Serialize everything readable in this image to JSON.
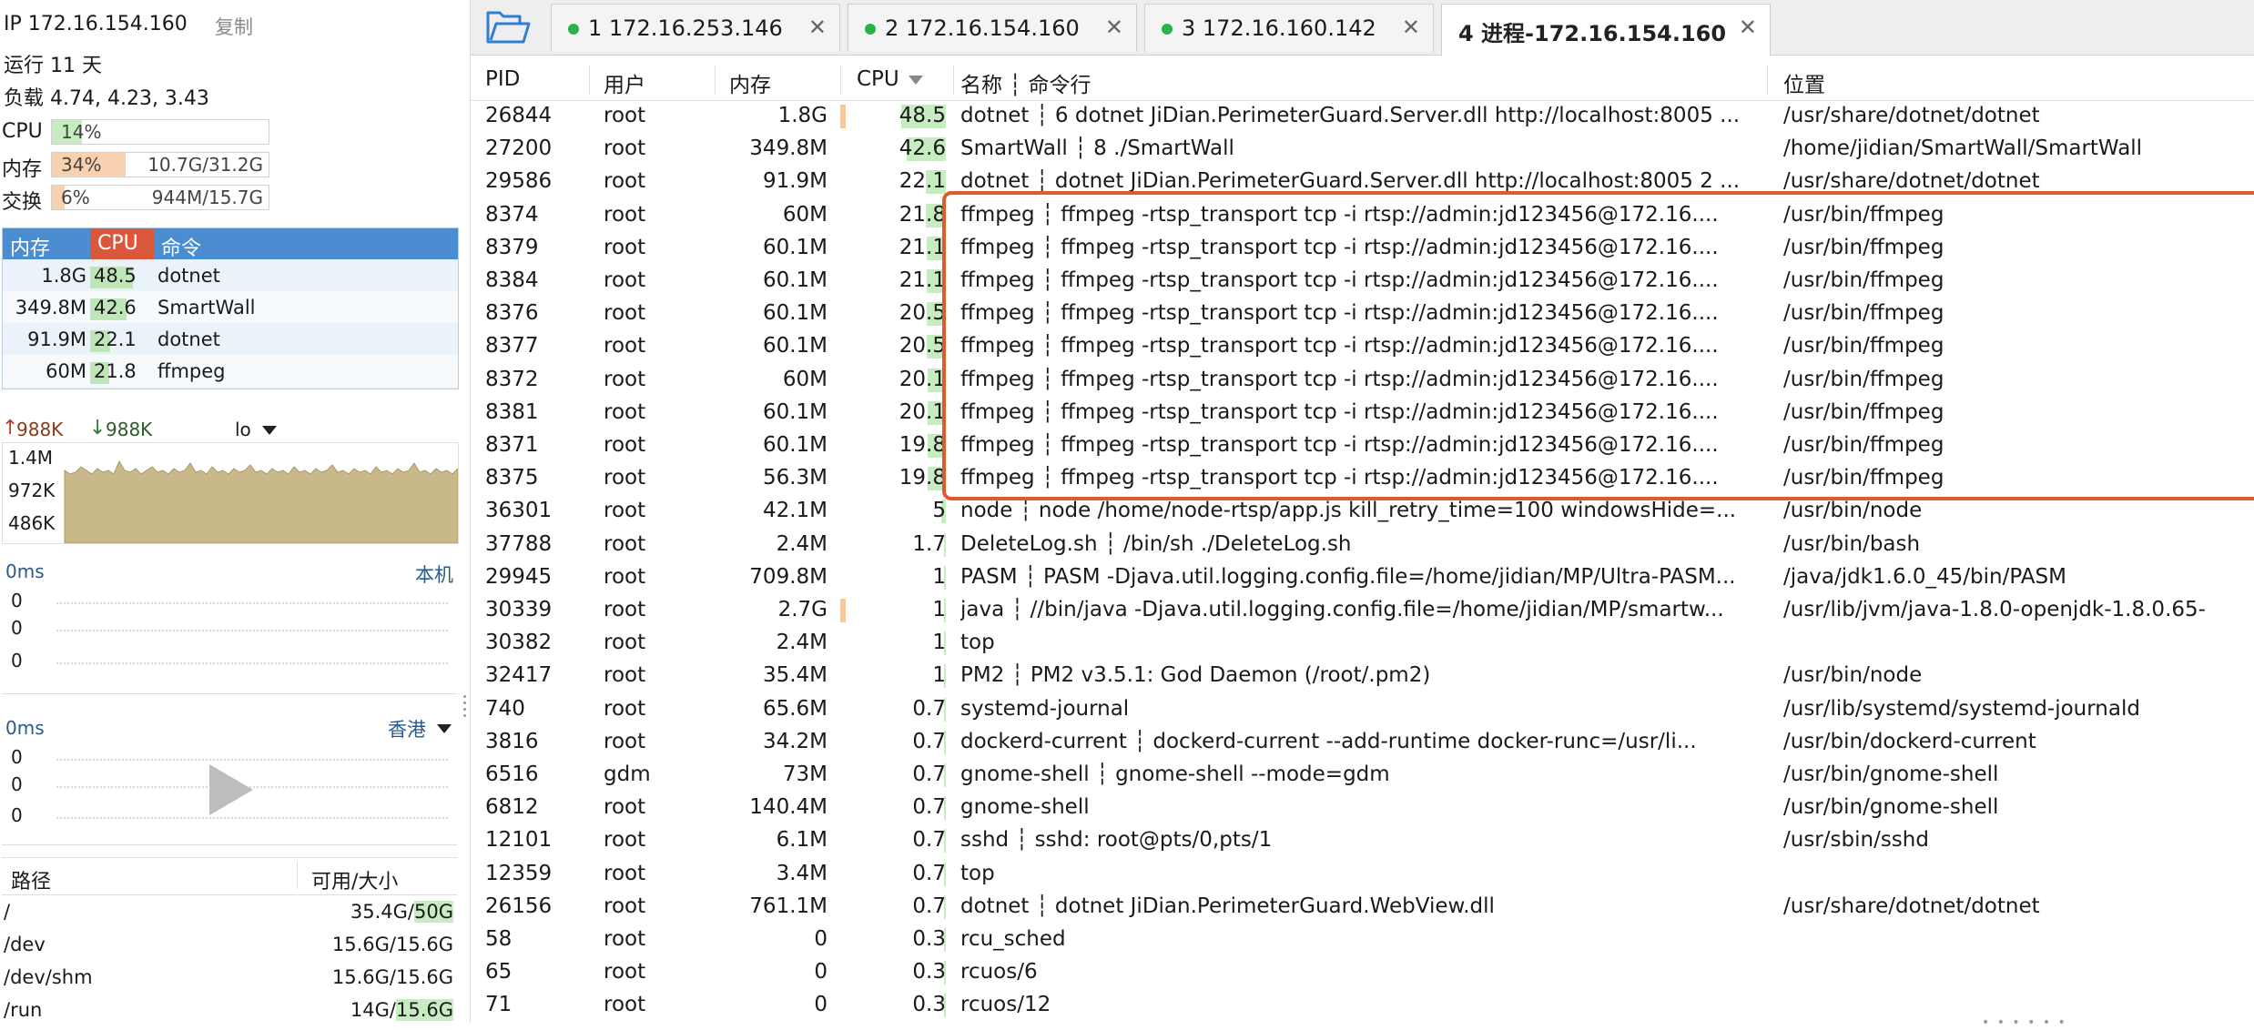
{
  "header": {
    "ip_label": "IP 172.16.154.160",
    "copy_label": "复制",
    "uptime": "运行 11 天",
    "load": "负载 4.74, 4.23, 3.43"
  },
  "meters": {
    "cpu": {
      "label": "CPU",
      "pct": "14%",
      "fraction": 0.14,
      "detail": "",
      "color": "#c8ecc2"
    },
    "mem": {
      "label": "内存",
      "pct": "34%",
      "fraction": 0.34,
      "detail": "10.7G/31.2G",
      "color": "#f8d1b0"
    },
    "swap": {
      "label": "交换",
      "pct": "6%",
      "fraction": 0.06,
      "detail": "944M/15.7G",
      "color": "#f8d1b0"
    }
  },
  "top_processes": {
    "headers": {
      "mem": "内存",
      "cpu": "CPU",
      "cmd": "命令"
    },
    "rows": [
      {
        "mem": "1.8G",
        "cpu": "48.5",
        "cmd": "dotnet"
      },
      {
        "mem": "349.8M",
        "cpu": "42.6",
        "cmd": "SmartWall"
      },
      {
        "mem": "91.9M",
        "cpu": "22.1",
        "cmd": "dotnet"
      },
      {
        "mem": "60M",
        "cpu": "21.8",
        "cmd": "ffmpeg"
      }
    ]
  },
  "network": {
    "up": "988K",
    "down": "988K",
    "interface": "lo",
    "y_labels": [
      "1.4M",
      "972K",
      "486K"
    ]
  },
  "ping_local": {
    "latency": "0ms",
    "target": "本机",
    "values": [
      "0",
      "0",
      "0"
    ]
  },
  "ping_hk": {
    "latency": "0ms",
    "target": "香港",
    "values": [
      "0",
      "0",
      "0"
    ]
  },
  "disk": {
    "headers": {
      "path": "路径",
      "size": "可用/大小"
    },
    "rows": [
      {
        "path": "/",
        "avail": "35.4G/",
        "total": "50G"
      },
      {
        "path": "/dev",
        "avail": "15.6G/15.6G",
        "total": ""
      },
      {
        "path": "/dev/shm",
        "avail": "15.6G/15.6G",
        "total": ""
      },
      {
        "path": "/run",
        "avail": "14G/",
        "total": "15.6G"
      }
    ]
  },
  "tabs": [
    {
      "label": "1  172.16.253.146",
      "active": false
    },
    {
      "label": "2  172.16.154.160",
      "active": false
    },
    {
      "label": "3  172.16.160.142",
      "active": false
    },
    {
      "label": "4  进程-172.16.154.160",
      "active": true
    }
  ],
  "table": {
    "headers": {
      "pid": "PID",
      "user": "用户",
      "mem": "内存",
      "cpu": "CPU",
      "name": "名称 ┆ 命令行",
      "loc": "位置"
    },
    "rows": [
      {
        "pid": "26844",
        "user": "root",
        "mem": "1.8G",
        "cpu": "48.5",
        "cpu_frac": 0.485,
        "mem_bar": true,
        "name": "dotnet ┆ 6 dotnet JiDian.PerimeterGuard.Server.dll http://localhost:8005 ...",
        "loc": "/usr/share/dotnet/dotnet"
      },
      {
        "pid": "27200",
        "user": "root",
        "mem": "349.8M",
        "cpu": "42.6",
        "cpu_frac": 0.426,
        "mem_bar": false,
        "name": "SmartWall ┆ 8 ./SmartWall",
        "loc": "/home/jidian/SmartWall/SmartWall"
      },
      {
        "pid": "29586",
        "user": "root",
        "mem": "91.9M",
        "cpu": "22.1",
        "cpu_frac": 0.221,
        "mem_bar": false,
        "name": "dotnet ┆ dotnet JiDian.PerimeterGuard.Server.dll http://localhost:8005 2 ...",
        "loc": "/usr/share/dotnet/dotnet"
      },
      {
        "pid": "8374",
        "user": "root",
        "mem": "60M",
        "cpu": "21.8",
        "cpu_frac": 0.218,
        "mem_bar": false,
        "name": "ffmpeg ┆ ffmpeg -rtsp_transport tcp -i rtsp://admin:jd123456@172.16....",
        "loc": "/usr/bin/ffmpeg"
      },
      {
        "pid": "8379",
        "user": "root",
        "mem": "60.1M",
        "cpu": "21.1",
        "cpu_frac": 0.211,
        "mem_bar": false,
        "name": "ffmpeg ┆ ffmpeg -rtsp_transport tcp -i rtsp://admin:jd123456@172.16....",
        "loc": "/usr/bin/ffmpeg"
      },
      {
        "pid": "8384",
        "user": "root",
        "mem": "60.1M",
        "cpu": "21.1",
        "cpu_frac": 0.211,
        "mem_bar": false,
        "name": "ffmpeg ┆ ffmpeg -rtsp_transport tcp -i rtsp://admin:jd123456@172.16....",
        "loc": "/usr/bin/ffmpeg"
      },
      {
        "pid": "8376",
        "user": "root",
        "mem": "60.1M",
        "cpu": "20.5",
        "cpu_frac": 0.205,
        "mem_bar": false,
        "name": "ffmpeg ┆ ffmpeg -rtsp_transport tcp -i rtsp://admin:jd123456@172.16....",
        "loc": "/usr/bin/ffmpeg"
      },
      {
        "pid": "8377",
        "user": "root",
        "mem": "60.1M",
        "cpu": "20.5",
        "cpu_frac": 0.205,
        "mem_bar": false,
        "name": "ffmpeg ┆ ffmpeg -rtsp_transport tcp -i rtsp://admin:jd123456@172.16....",
        "loc": "/usr/bin/ffmpeg"
      },
      {
        "pid": "8372",
        "user": "root",
        "mem": "60M",
        "cpu": "20.1",
        "cpu_frac": 0.201,
        "mem_bar": false,
        "name": "ffmpeg ┆ ffmpeg -rtsp_transport tcp -i rtsp://admin:jd123456@172.16....",
        "loc": "/usr/bin/ffmpeg"
      },
      {
        "pid": "8381",
        "user": "root",
        "mem": "60.1M",
        "cpu": "20.1",
        "cpu_frac": 0.201,
        "mem_bar": false,
        "name": "ffmpeg ┆ ffmpeg -rtsp_transport tcp -i rtsp://admin:jd123456@172.16....",
        "loc": "/usr/bin/ffmpeg"
      },
      {
        "pid": "8371",
        "user": "root",
        "mem": "60.1M",
        "cpu": "19.8",
        "cpu_frac": 0.198,
        "mem_bar": false,
        "name": "ffmpeg ┆ ffmpeg -rtsp_transport tcp -i rtsp://admin:jd123456@172.16....",
        "loc": "/usr/bin/ffmpeg"
      },
      {
        "pid": "8375",
        "user": "root",
        "mem": "56.3M",
        "cpu": "19.8",
        "cpu_frac": 0.198,
        "mem_bar": false,
        "name": "ffmpeg ┆ ffmpeg -rtsp_transport tcp -i rtsp://admin:jd123456@172.16....",
        "loc": "/usr/bin/ffmpeg"
      },
      {
        "pid": "36301",
        "user": "root",
        "mem": "42.1M",
        "cpu": "5",
        "cpu_frac": 0.05,
        "mem_bar": false,
        "name": "node ┆ node /home/node-rtsp/app.js kill_retry_time=100 windowsHide=...",
        "loc": "/usr/bin/node"
      },
      {
        "pid": "37788",
        "user": "root",
        "mem": "2.4M",
        "cpu": "1.7",
        "cpu_frac": 0.017,
        "mem_bar": false,
        "name": "DeleteLog.sh ┆ /bin/sh ./DeleteLog.sh",
        "loc": "/usr/bin/bash"
      },
      {
        "pid": "29945",
        "user": "root",
        "mem": "709.8M",
        "cpu": "1",
        "cpu_frac": 0.01,
        "mem_bar": false,
        "name": "PASM ┆ PASM  -Djava.util.logging.config.file=/home/jidian/MP/Ultra-PASM...",
        "loc": "/java/jdk1.6.0_45/bin/PASM"
      },
      {
        "pid": "30339",
        "user": "root",
        "mem": "2.7G",
        "cpu": "1",
        "cpu_frac": 0.01,
        "mem_bar": true,
        "name": "java ┆ //bin/java -Djava.util.logging.config.file=/home/jidian/MP/smartw...",
        "loc": "/usr/lib/jvm/java-1.8.0-openjdk-1.8.0.65-"
      },
      {
        "pid": "30382",
        "user": "root",
        "mem": "2.4M",
        "cpu": "1",
        "cpu_frac": 0.01,
        "mem_bar": false,
        "name": "top",
        "loc": ""
      },
      {
        "pid": "32417",
        "user": "root",
        "mem": "35.4M",
        "cpu": "1",
        "cpu_frac": 0.01,
        "mem_bar": false,
        "name": "PM2 ┆ PM2 v3.5.1: God Daemon (/root/.pm2)",
        "loc": "/usr/bin/node"
      },
      {
        "pid": "740",
        "user": "root",
        "mem": "65.6M",
        "cpu": "0.7",
        "cpu_frac": 0.007,
        "mem_bar": false,
        "name": "systemd-journal",
        "loc": "/usr/lib/systemd/systemd-journald"
      },
      {
        "pid": "3816",
        "user": "root",
        "mem": "34.2M",
        "cpu": "0.7",
        "cpu_frac": 0.007,
        "mem_bar": false,
        "name": "dockerd-current ┆ dockerd-current  --add-runtime docker-runc=/usr/li...",
        "loc": "/usr/bin/dockerd-current"
      },
      {
        "pid": "6516",
        "user": "gdm",
        "mem": "73M",
        "cpu": "0.7",
        "cpu_frac": 0.007,
        "mem_bar": false,
        "name": "gnome-shell ┆ gnome-shell --mode=gdm",
        "loc": "/usr/bin/gnome-shell"
      },
      {
        "pid": "6812",
        "user": "root",
        "mem": "140.4M",
        "cpu": "0.7",
        "cpu_frac": 0.007,
        "mem_bar": false,
        "name": "gnome-shell",
        "loc": "/usr/bin/gnome-shell"
      },
      {
        "pid": "12101",
        "user": "root",
        "mem": "6.1M",
        "cpu": "0.7",
        "cpu_frac": 0.007,
        "mem_bar": false,
        "name": "sshd ┆ sshd: root@pts/0,pts/1",
        "loc": "/usr/sbin/sshd"
      },
      {
        "pid": "12359",
        "user": "root",
        "mem": "3.4M",
        "cpu": "0.7",
        "cpu_frac": 0.007,
        "mem_bar": false,
        "name": "top",
        "loc": ""
      },
      {
        "pid": "26156",
        "user": "root",
        "mem": "761.1M",
        "cpu": "0.7",
        "cpu_frac": 0.007,
        "mem_bar": false,
        "name": "dotnet ┆ dotnet JiDian.PerimeterGuard.WebView.dll",
        "loc": "/usr/share/dotnet/dotnet"
      },
      {
        "pid": "58",
        "user": "root",
        "mem": "0",
        "cpu": "0.3",
        "cpu_frac": 0.003,
        "mem_bar": false,
        "name": "rcu_sched",
        "loc": ""
      },
      {
        "pid": "65",
        "user": "root",
        "mem": "0",
        "cpu": "0.3",
        "cpu_frac": 0.003,
        "mem_bar": false,
        "name": "rcuos/6",
        "loc": ""
      },
      {
        "pid": "71",
        "user": "root",
        "mem": "0",
        "cpu": "0.3",
        "cpu_frac": 0.003,
        "mem_bar": false,
        "name": "rcuos/12",
        "loc": ""
      }
    ]
  }
}
